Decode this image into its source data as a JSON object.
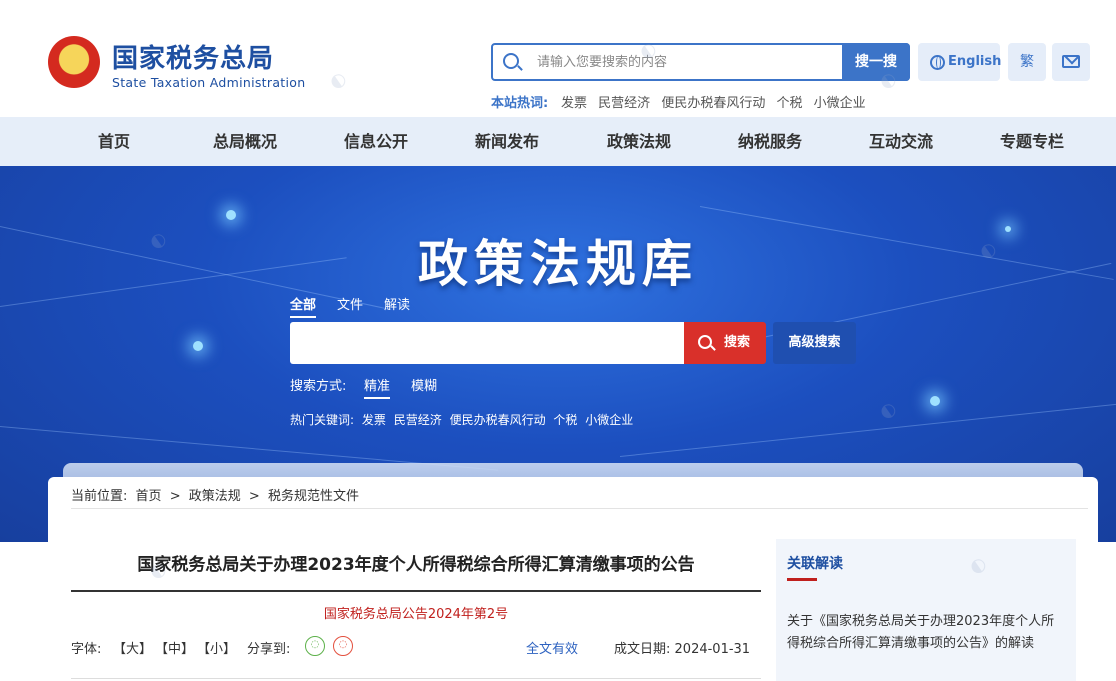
{
  "header": {
    "logo_cn": "国家税务总局",
    "logo_en": "State Taxation Administration",
    "search_placeholder": "请输入您要搜索的内容",
    "search_button": "搜一搜",
    "english_button": "English",
    "traditional_button": "繁",
    "hot_label": "本站热词:",
    "hot_words": [
      "发票",
      "民营经济",
      "便民办税春风行动",
      "个税",
      "小微企业"
    ]
  },
  "nav": {
    "items": [
      "首页",
      "总局概况",
      "信息公开",
      "新闻发布",
      "政策法规",
      "纳税服务",
      "互动交流",
      "专题专栏"
    ]
  },
  "banner": {
    "title": "政策法规库",
    "tabs": [
      "全部",
      "文件",
      "解读"
    ],
    "search_value": "",
    "search_button": "搜索",
    "advanced_button": "高级搜索",
    "mode_label": "搜索方式:",
    "modes": [
      "精准",
      "模糊"
    ],
    "keywords_label": "热门关键词:",
    "keywords": [
      "发票",
      "民营经济",
      "便民办税春风行动",
      "个税",
      "小微企业"
    ]
  },
  "breadcrumb": {
    "label": "当前位置:",
    "items": [
      "首页",
      ">",
      "政策法规",
      ">",
      "税务规范性文件"
    ]
  },
  "article": {
    "title": "国家税务总局关于办理2023年度个人所得税综合所得汇算清缴事项的公告",
    "doc_number": "国家税务总局公告2024年第2号",
    "font_label": "字体:",
    "font_large": "【大】",
    "font_medium": "【中】",
    "font_small": "【小】",
    "share_label": "分享到:",
    "validity": "全文有效",
    "date_label": "成文日期:",
    "date_value": "2024-01-31"
  },
  "sidebar": {
    "title": "关联解读",
    "text": "关于《国家税务总局关于办理2023年度个人所得税综合所得汇算清缴事项的公告》的解读"
  },
  "colors": {
    "primary": "#1e4fa1",
    "accent_red": "#d9302a",
    "nav_bg": "#e6eef9"
  }
}
